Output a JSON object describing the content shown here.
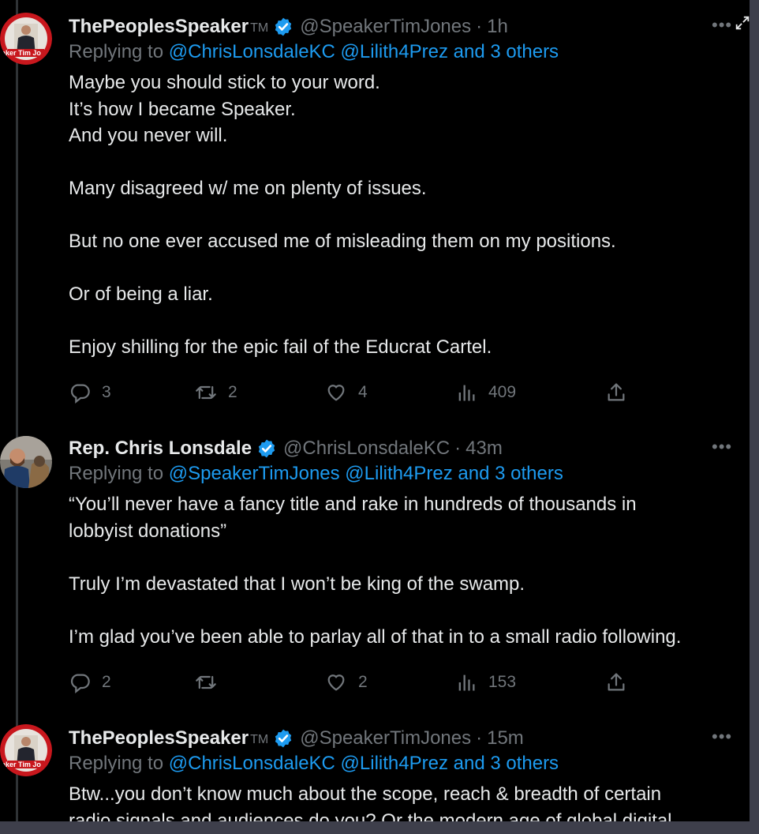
{
  "tweets": [
    {
      "name": "ThePeoplesSpeaker",
      "tm": "TM",
      "handle": "@SpeakerTimJones",
      "time": "1h",
      "replying_label": "Replying to",
      "replying_to": "@ChrisLonsdaleKC @Lilith4Prez and 3 others",
      "body": [
        "Maybe you should stick to your word.",
        "It’s how I became Speaker.",
        "And you never will.",
        "",
        "Many disagreed w/ me on plenty of issues.",
        "",
        "But no one ever accused me of misleading them on my positions.",
        "",
        "Or of being a liar.",
        "",
        "Enjoy shilling for the epic fail of the Educrat Cartel."
      ],
      "stats": {
        "replies": "3",
        "retweets": "2",
        "likes": "4",
        "views": "409"
      }
    },
    {
      "name": "Rep. Chris Lonsdale",
      "handle": "@ChrisLonsdaleKC",
      "time": "43m",
      "replying_label": "Replying to",
      "replying_to": "@SpeakerTimJones @Lilith4Prez and 3 others",
      "body": [
        "“You’ll never have a fancy title and rake in hundreds of thousands in",
        "lobbyist donations”",
        "",
        "Truly I’m devastated that I won’t be king of the swamp.",
        "",
        "I’m glad you’ve been able to parlay all of that in to a small radio following."
      ],
      "stats": {
        "replies": "2",
        "retweets": "",
        "likes": "2",
        "views": "153"
      }
    },
    {
      "name": "ThePeoplesSpeaker",
      "tm": "TM",
      "handle": "@SpeakerTimJones",
      "time": "15m",
      "replying_label": "Replying to",
      "replying_to": "@ChrisLonsdaleKC @Lilith4Prez and 3 others",
      "body": [
        "Btw...you don’t know much about the scope, reach & breadth of certain",
        "radio signals and audiences do you? Or the modern age of global digital"
      ]
    }
  ],
  "avatar_1_text": "aker Tim Jo",
  "avatar_3_text": "aker Tim Jo",
  "separator": "·",
  "colors": {
    "background": "#000000",
    "text": "#e7e9ea",
    "muted": "#71767b",
    "link": "#1d9bf0",
    "verified": "#1d9bf0",
    "frame": "#3e3f4b"
  }
}
